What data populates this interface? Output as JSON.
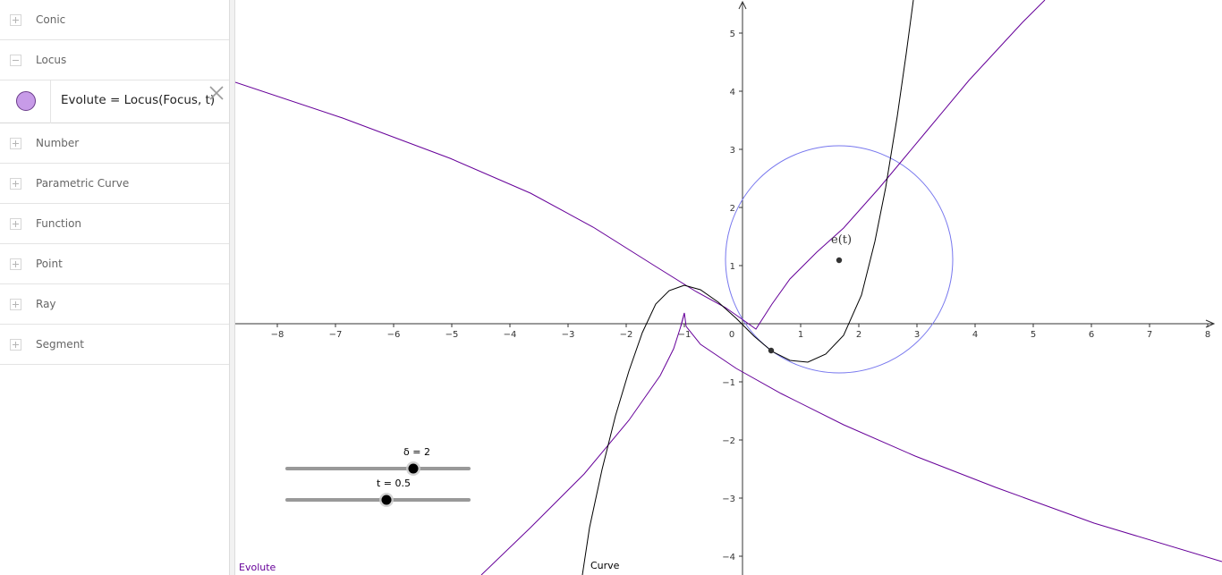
{
  "algebra": {
    "categories_top": [
      {
        "label": "Conic",
        "expanded": false
      },
      {
        "label": "Locus",
        "expanded": true
      }
    ],
    "object": {
      "definition": "Evolute = Locus(Focus, t)",
      "color": "#c79be8",
      "close_icon": "close-icon"
    },
    "categories_bottom": [
      {
        "label": "Number",
        "expanded": false
      },
      {
        "label": "Parametric Curve",
        "expanded": false
      },
      {
        "label": "Function",
        "expanded": false
      },
      {
        "label": "Point",
        "expanded": false
      },
      {
        "label": "Ray",
        "expanded": false
      },
      {
        "label": "Segment",
        "expanded": false
      }
    ]
  },
  "graphics": {
    "x_ticks": [
      "−8",
      "−7",
      "−6",
      "−5",
      "−4",
      "−3",
      "−2",
      "−1",
      "0",
      "1",
      "2",
      "3",
      "4",
      "5",
      "6",
      "7",
      "8"
    ],
    "y_ticks": [
      "5",
      "4",
      "3",
      "2",
      "1",
      "−1",
      "−2",
      "−3",
      "−4"
    ],
    "x_range": [
      -8.7,
      8.3
    ],
    "y_range": [
      -4.3,
      5.6
    ],
    "colors": {
      "curve": "#000000",
      "evolute": "#660099",
      "circle": "#7777ee"
    },
    "point_label": "e(t)",
    "evolute_label": "Evolute",
    "curve_label": "Curve",
    "sliders": [
      {
        "label": "δ = 2",
        "value": 2,
        "min": -3,
        "max": 3
      },
      {
        "label": "t = 0.5",
        "value": 0.5,
        "min": -2,
        "max": 2
      }
    ]
  }
}
